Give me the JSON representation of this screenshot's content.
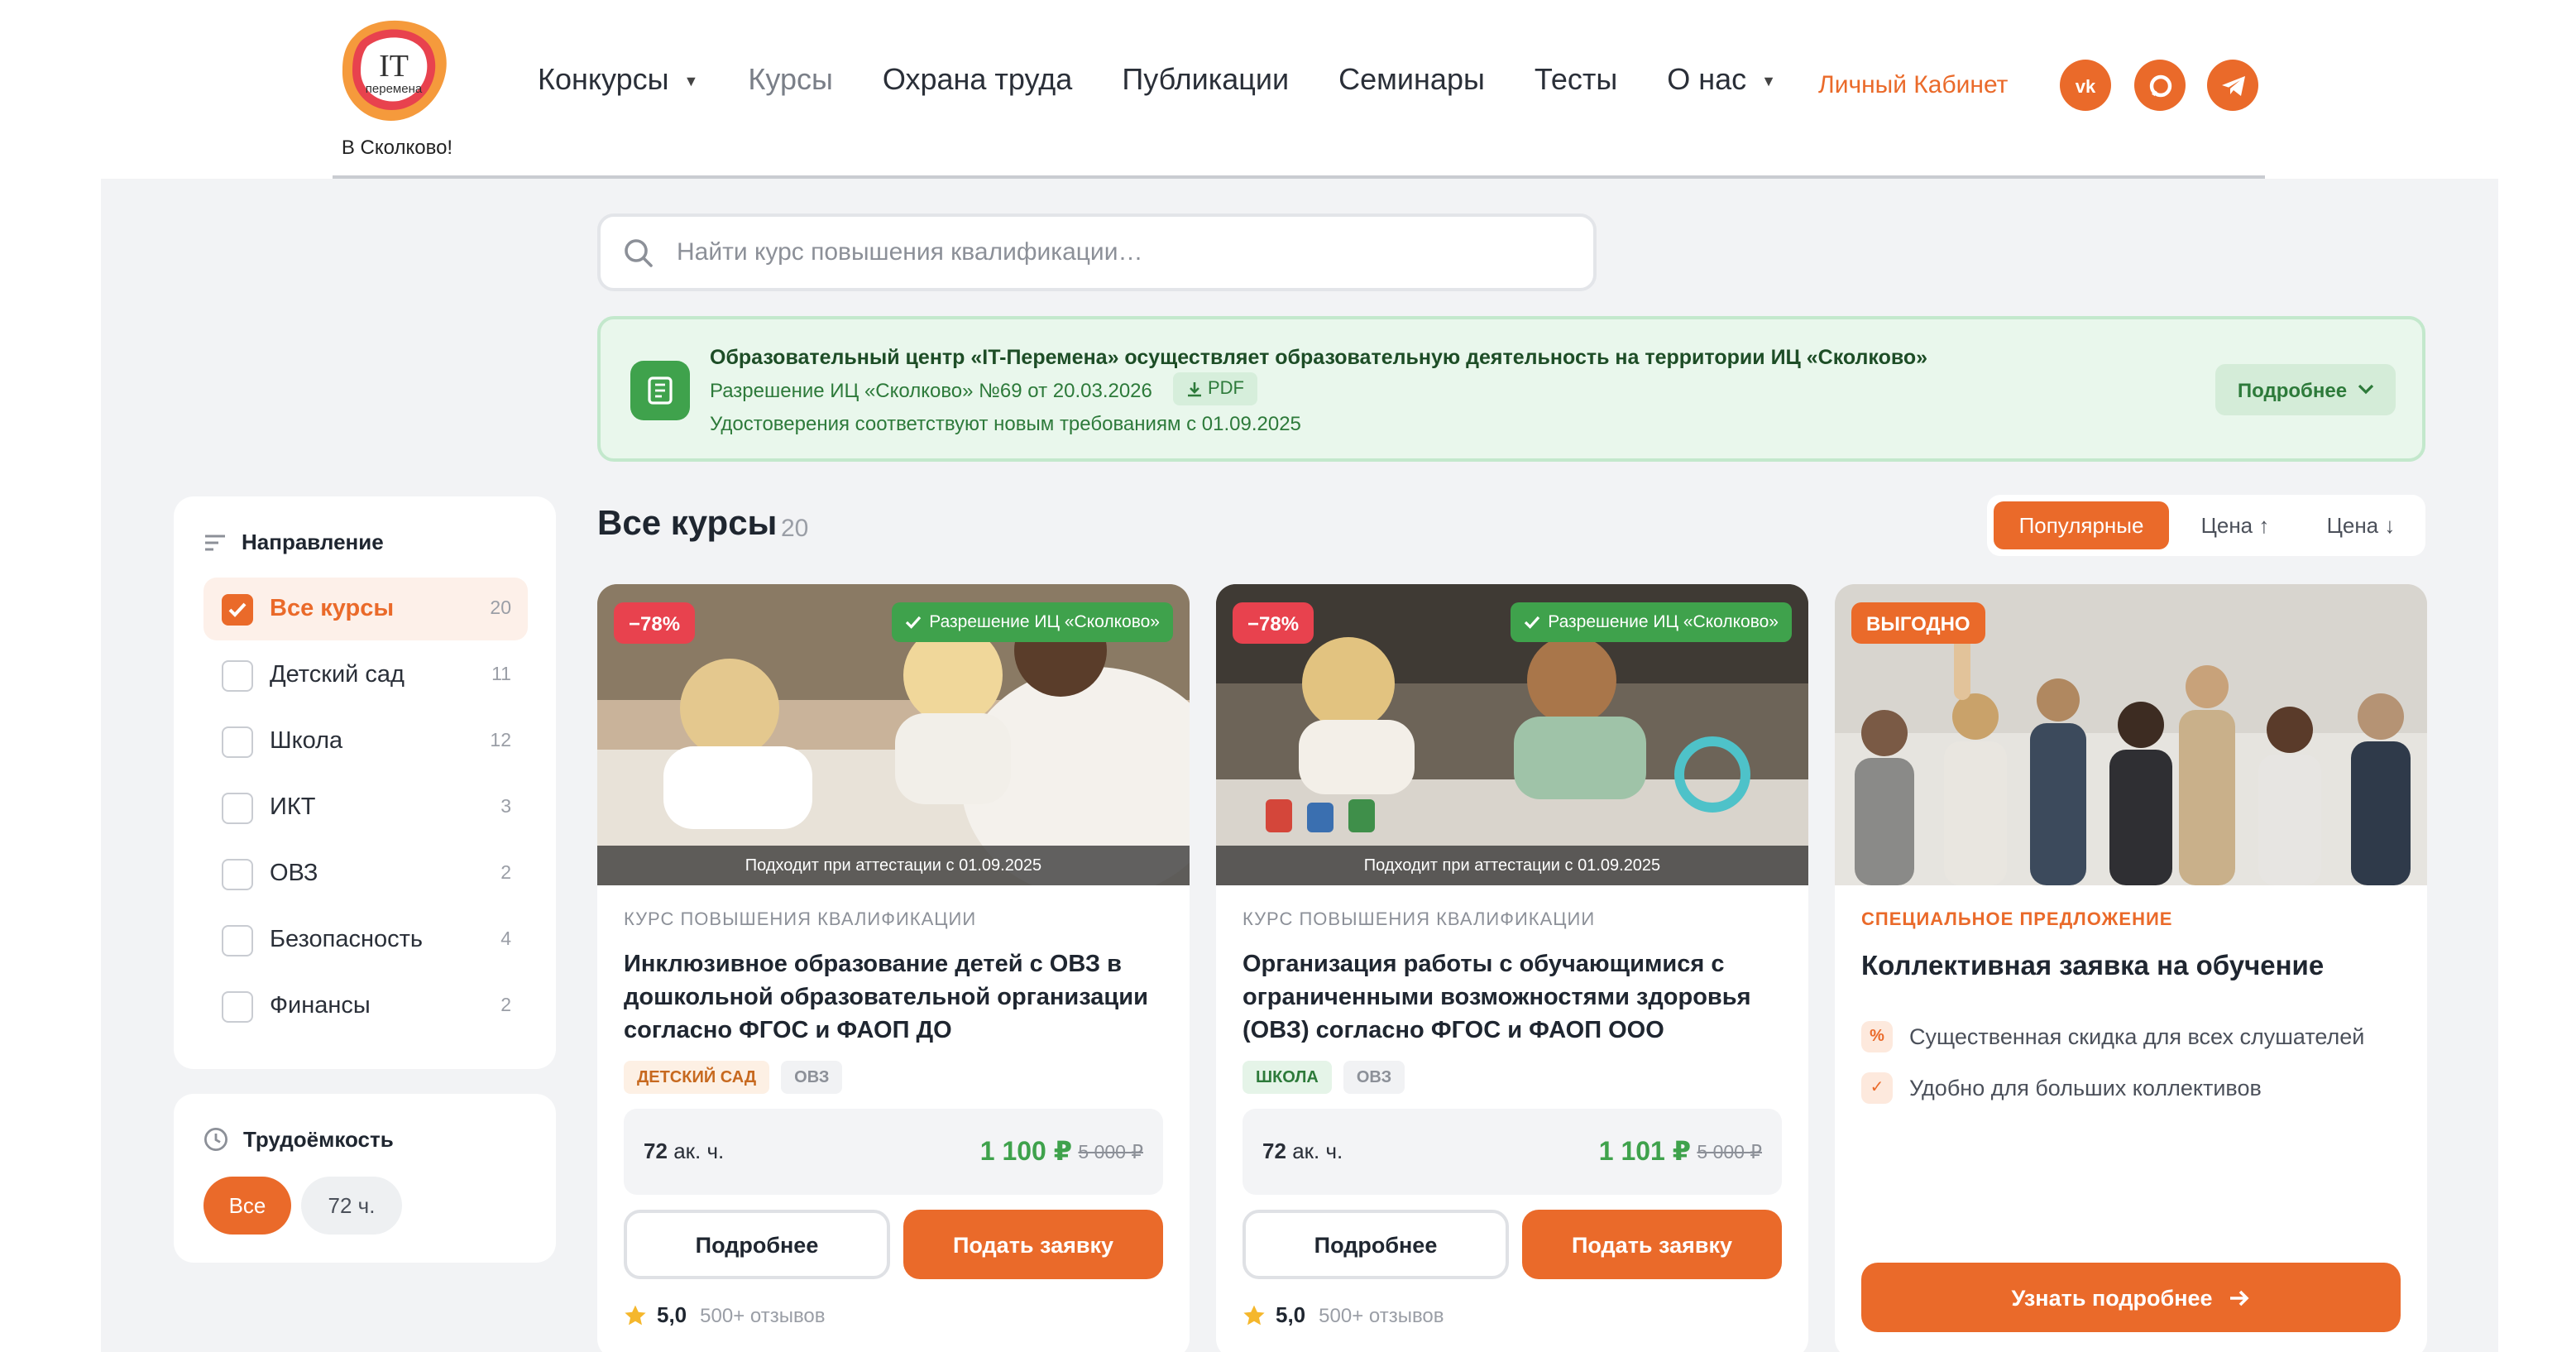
{
  "colors": {
    "accent": "#ea6a2a",
    "green": "#3fa24c",
    "discount_red": "#e8424e",
    "page_bg": "#f2f3f5"
  },
  "logo": {
    "mark": "IT",
    "sub": "перемена",
    "caption": "В Сколково!"
  },
  "nav": {
    "items": [
      {
        "label": "Конкурсы",
        "dropdown": true
      },
      {
        "label": "Курсы",
        "active": true
      },
      {
        "label": "Охрана труда"
      },
      {
        "label": "Публикации"
      },
      {
        "label": "Семинары"
      },
      {
        "label": "Тесты"
      },
      {
        "label": "О нас",
        "dropdown": true
      }
    ],
    "cabinet_label": "Личный Кабинет",
    "social_icons": [
      "vk-icon",
      "max-messenger-icon",
      "telegram-icon"
    ]
  },
  "search": {
    "placeholder": "Найти курс повышения квалификации…",
    "value": ""
  },
  "banner": {
    "title": "Образовательный центр «IT-Перемена» осуществляет образовательную деятельность на территории ИЦ «Сколково»",
    "permit": "Разрешение ИЦ «Сколково» №69 от 20.03.2026",
    "pdf_label": "PDF",
    "note": "Удостоверения соответствуют новым требованиям с 01.09.2025",
    "more_label": "Подробнее"
  },
  "sidebar": {
    "direction_title": "Направление",
    "filters": [
      {
        "label": "Все курсы",
        "count": "20",
        "checked": true
      },
      {
        "label": "Детский сад",
        "count": "11",
        "checked": false
      },
      {
        "label": "Школа",
        "count": "12",
        "checked": false
      },
      {
        "label": "ИКТ",
        "count": "3",
        "checked": false
      },
      {
        "label": "ОВЗ",
        "count": "2",
        "checked": false
      },
      {
        "label": "Безопасность",
        "count": "4",
        "checked": false
      },
      {
        "label": "Финансы",
        "count": "2",
        "checked": false
      }
    ],
    "labor_title": "Трудоёмкость",
    "labor_options": [
      {
        "label": "Все",
        "active": true
      },
      {
        "label": "72 ч.",
        "active": false
      }
    ]
  },
  "courses": {
    "title": "Все курсы",
    "count": "20",
    "sort": [
      {
        "label": "Популярные",
        "active": true
      },
      {
        "label": "Цена ↑",
        "active": false
      },
      {
        "label": "Цена ↓",
        "active": false
      }
    ],
    "cards": [
      {
        "discount": "−78%",
        "permit_badge": "Разрешение ИЦ «Сколково»",
        "attestation": "Подходит при аттестации с 01.09.2025",
        "kicker": "КУРС ПОВЫШЕНИЯ КВАЛИФИКАЦИИ",
        "title": "Инклюзивное образование детей с ОВЗ в дошкольной образовательной организации согласно ФГОС и ФАОП ДО",
        "tags": [
          "ДЕТСКИЙ САД",
          "ОВЗ"
        ],
        "hours": "72",
        "hours_unit": "ак. ч.",
        "price": "1 100 ₽",
        "old_price": "5 000 ₽",
        "details_label": "Подробнее",
        "apply_label": "Подать заявку",
        "rating": "5,0",
        "reviews": "500+ отзывов"
      },
      {
        "discount": "−78%",
        "permit_badge": "Разрешение ИЦ «Сколково»",
        "attestation": "Подходит при аттестации с 01.09.2025",
        "kicker": "КУРС ПОВЫШЕНИЯ КВАЛИФИКАЦИИ",
        "title": "Организация работы с обучающимися с ограниченными возможностями здоровья (ОВЗ) согласно ФГОС и ФАОП ООО",
        "tags": [
          "ШКОЛА",
          "ОВЗ"
        ],
        "hours": "72",
        "hours_unit": "ак. ч.",
        "price": "1 101 ₽",
        "old_price": "5 000 ₽",
        "details_label": "Подробнее",
        "apply_label": "Подать заявку",
        "rating": "5,0",
        "reviews": "500+ отзывов"
      }
    ],
    "offer": {
      "badge": "ВЫГОДНО",
      "kicker": "СПЕЦИАЛЬНОЕ ПРЕДЛОЖЕНИЕ",
      "title": "Коллективная заявка на обучение",
      "benefits": [
        {
          "icon": "%",
          "text": "Существенная скидка для всех слушателей"
        },
        {
          "icon": "✓",
          "text": "Удобно для больших коллективов"
        }
      ],
      "button_label": "Узнать подробнее"
    }
  }
}
